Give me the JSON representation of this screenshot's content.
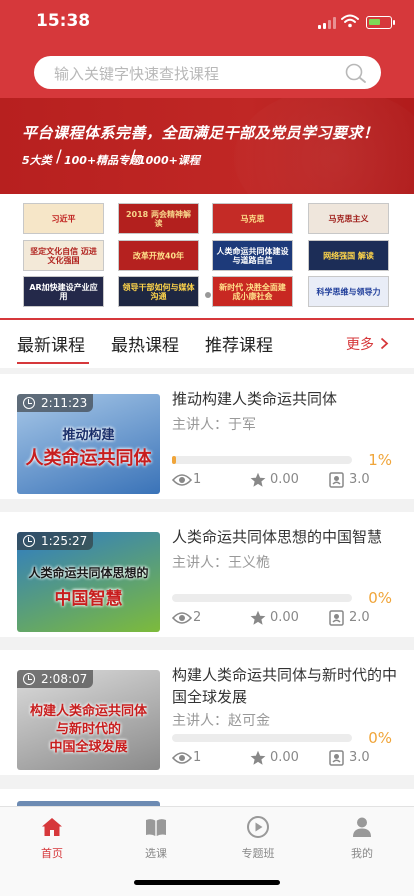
{
  "status_bar": {
    "time": "15:38"
  },
  "search": {
    "placeholder": "输入关键字快速查找课程"
  },
  "banner": {
    "headline": "平台课程体系完善，全面满足干部及党员学习要求！",
    "stats": [
      "5大类",
      "100+精品专题",
      "1000+课程"
    ]
  },
  "thumbs": [
    {
      "text": "习近平",
      "bg": "#f6e6c8",
      "fg": "#c0211f"
    },
    {
      "text": "2018 两会精神解读",
      "bg": "#b3201e",
      "fg": "#f7d48a"
    },
    {
      "text": "马克思",
      "bg": "#c42b26",
      "fg": "#ffe08a"
    },
    {
      "text": "马克思主义",
      "bg": "#efe6dc",
      "fg": "#a0201c"
    },
    {
      "text": "坚定文化自信 迈进文化强国",
      "bg": "#f3e9d8",
      "fg": "#b0221e"
    },
    {
      "text": "改革开放40年",
      "bg": "#b5211f",
      "fg": "#ffe08a"
    },
    {
      "text": "人类命运共同体建设与道路自信",
      "bg": "#1d3a7a",
      "fg": "#ffffff"
    },
    {
      "text": "网络强国 解读",
      "bg": "#1c2d57",
      "fg": "#ffd54a"
    },
    {
      "text": "AR加快建设产业应用",
      "bg": "#24294a",
      "fg": "#ffffff"
    },
    {
      "text": "领导干部如何与媒体沟通",
      "bg": "#1e2742",
      "fg": "#ffd54a"
    },
    {
      "text": "新时代 决胜全面建成小康社会",
      "bg": "#c82822",
      "fg": "#ffe08a"
    },
    {
      "text": "科学思维与领导力",
      "bg": "#e9edf7",
      "fg": "#1f3d9a"
    }
  ],
  "tabs": [
    "最新课程",
    "最热课程",
    "推荐课程"
  ],
  "more_label": "更多",
  "speaker_prefix": "主讲人：",
  "courses": [
    {
      "duration": "2:11:23",
      "title": "推动构建人类命运共同体",
      "lecturer": "于军",
      "progress": 0.01,
      "progress_label": "1%",
      "views": "1",
      "rating": "0.00",
      "credits": "3.0",
      "thumb_caption": [
        "推动构建",
        "人类命运共同体"
      ],
      "thumb_colors": [
        "#3a73b8",
        "#a8c8e8"
      ]
    },
    {
      "duration": "1:25:27",
      "title": "人类命运共同体思想的中国智慧",
      "lecturer": "王义桅",
      "progress": 0,
      "progress_label": "0%",
      "views": "2",
      "rating": "0.00",
      "credits": "2.0",
      "thumb_caption": [
        "人类命运共同体思想的",
        "中国智慧"
      ],
      "thumb_colors": [
        "#7dbb3b",
        "#2f7cc4"
      ]
    },
    {
      "duration": "2:08:07",
      "title": "构建人类命运共同体与新时代的中国全球发展",
      "lecturer": "赵可金",
      "progress": 0,
      "progress_label": "0%",
      "views": "1",
      "rating": "0.00",
      "credits": "3.0",
      "thumb_caption": [
        "构建人类命运共同体",
        "与新时代的",
        "中国全球发展"
      ],
      "thumb_colors": [
        "#8a8a8a",
        "#dcdcdc"
      ]
    }
  ],
  "tabbar": [
    {
      "label": "首页",
      "icon": "home-icon",
      "active": true
    },
    {
      "label": "选课",
      "icon": "book-icon",
      "active": false
    },
    {
      "label": "专题班",
      "icon": "play-circle-icon",
      "active": false
    },
    {
      "label": "我的",
      "icon": "user-icon",
      "active": false
    }
  ],
  "colors": {
    "primary": "#d6383b",
    "progress": "#f0a53a",
    "inactive": "#888888"
  }
}
